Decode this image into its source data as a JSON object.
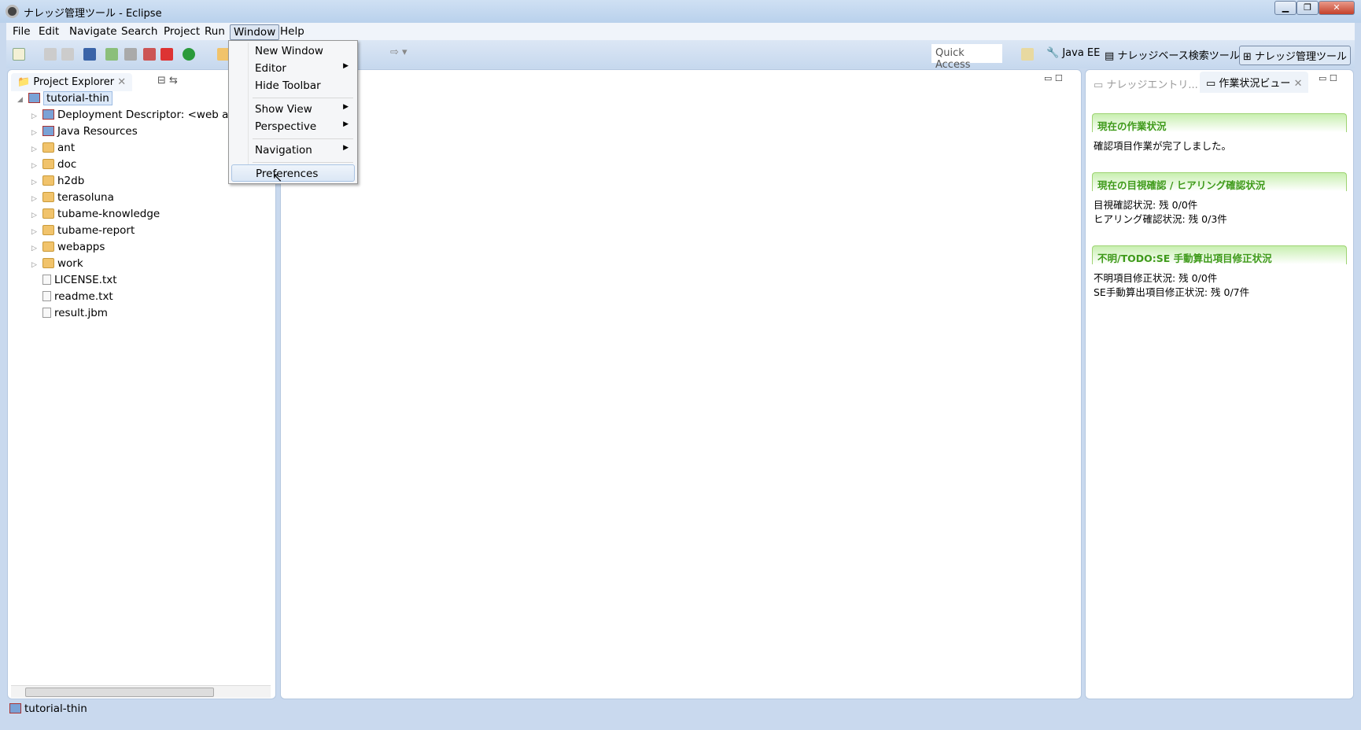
{
  "window": {
    "title": "ナレッジ管理ツール - Eclipse",
    "buttons": [
      "minimize",
      "maximize",
      "close"
    ]
  },
  "menubar": [
    "File",
    "Edit",
    "Navigate",
    "Search",
    "Project",
    "Run",
    "Window",
    "Help"
  ],
  "window_menu": {
    "items": [
      {
        "label": "New Window"
      },
      {
        "label": "Editor",
        "submenu": true
      },
      {
        "label": "Hide Toolbar"
      },
      {
        "label": "Show View",
        "submenu": true
      },
      {
        "label": "Perspective",
        "submenu": true
      },
      {
        "label": "Navigation",
        "submenu": true
      },
      {
        "label": "Preferences",
        "highlighted": true
      }
    ]
  },
  "toolbar": {
    "quick_access_placeholder": "Quick Access",
    "perspectives": [
      "Java EE",
      "ナレッジベース検索ツール",
      "ナレッジ管理ツール"
    ],
    "active_perspective": "ナレッジ管理ツール"
  },
  "project_explorer": {
    "tab": "Project Explorer",
    "root": "tutorial-thin",
    "children": [
      {
        "label": "Deployment Descriptor: <web app>",
        "icon": "descriptor-icon",
        "expandable": true
      },
      {
        "label": "Java Resources",
        "icon": "java-resources-icon",
        "expandable": true
      },
      {
        "label": "ant",
        "icon": "folder-icon",
        "expandable": true
      },
      {
        "label": "doc",
        "icon": "folder-icon",
        "expandable": true
      },
      {
        "label": "h2db",
        "icon": "folder-icon",
        "expandable": true
      },
      {
        "label": "terasoluna",
        "icon": "folder-icon",
        "expandable": true
      },
      {
        "label": "tubame-knowledge",
        "icon": "folder-icon",
        "expandable": true
      },
      {
        "label": "tubame-report",
        "icon": "folder-icon",
        "expandable": true
      },
      {
        "label": "webapps",
        "icon": "folder-icon",
        "expandable": true
      },
      {
        "label": "work",
        "icon": "folder-icon",
        "expandable": true
      },
      {
        "label": "LICENSE.txt",
        "icon": "file-icon",
        "expandable": false
      },
      {
        "label": "readme.txt",
        "icon": "file-icon",
        "expandable": false
      },
      {
        "label": "result.jbm",
        "icon": "file-icon",
        "expandable": false
      }
    ]
  },
  "right_view": {
    "tabs": [
      "ナレッジエントリ...",
      "作業状況ビュー"
    ],
    "active_tab": "作業状況ビュー",
    "sections": [
      {
        "title": "現在の作業状況",
        "lines": [
          "確認項目作業が完了しました。"
        ]
      },
      {
        "title": "現在の目視確認 / ヒアリング確認状況",
        "lines": [
          "目視確認状況: 残 0/0件",
          "ヒアリング確認状況: 残 0/3件"
        ]
      },
      {
        "title": "不明/TODO:SE 手動算出項目修正状況",
        "lines": [
          "不明項目修正状況: 残 0/0件",
          "SE手動算出項目修正状況: 残 0/7件"
        ]
      }
    ]
  },
  "statusbar": {
    "selection": "tutorial-thin"
  },
  "colors": {
    "section_title": "#3e9a1a",
    "frame": "#c9d9ee"
  }
}
